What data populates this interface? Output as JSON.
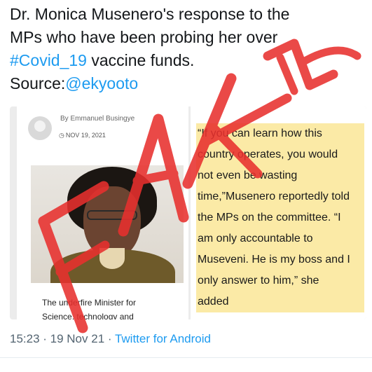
{
  "tweet": {
    "text_lines": [
      "Dr. Monica Musenero's response to the",
      "MPs who have been probing her over"
    ],
    "line3_hashtag": "#Covid_19",
    "line3_rest": " vaccine funds.",
    "line4_prefix": "Source:",
    "line4_handle": "@ekyooto"
  },
  "article": {
    "byline": "By Emmanuel Busingye",
    "date": "NOV 19, 2021",
    "date_icon": "clock-icon",
    "caption_lines": [
      "The underfire Minister for",
      "Science, technology and"
    ],
    "quote_lines": [
      "“If you can learn how this",
      "country operates, you would",
      "not even be wasting",
      "time,”Musenero reportedly told",
      "the MPs on the committee. “I",
      "am only accountable to",
      "Museveni. He is my boss and I",
      "only answer to him,” she",
      "added"
    ]
  },
  "meta": {
    "time_date": "15:23 · 19 Nov 21 · ",
    "app": "Twitter for Android"
  },
  "overlay": {
    "stamp": "FAKE",
    "color": "#e8302e"
  },
  "colors": {
    "link": "#1d9bf0",
    "highlight": "#fbeaa6",
    "meta": "#536471"
  }
}
